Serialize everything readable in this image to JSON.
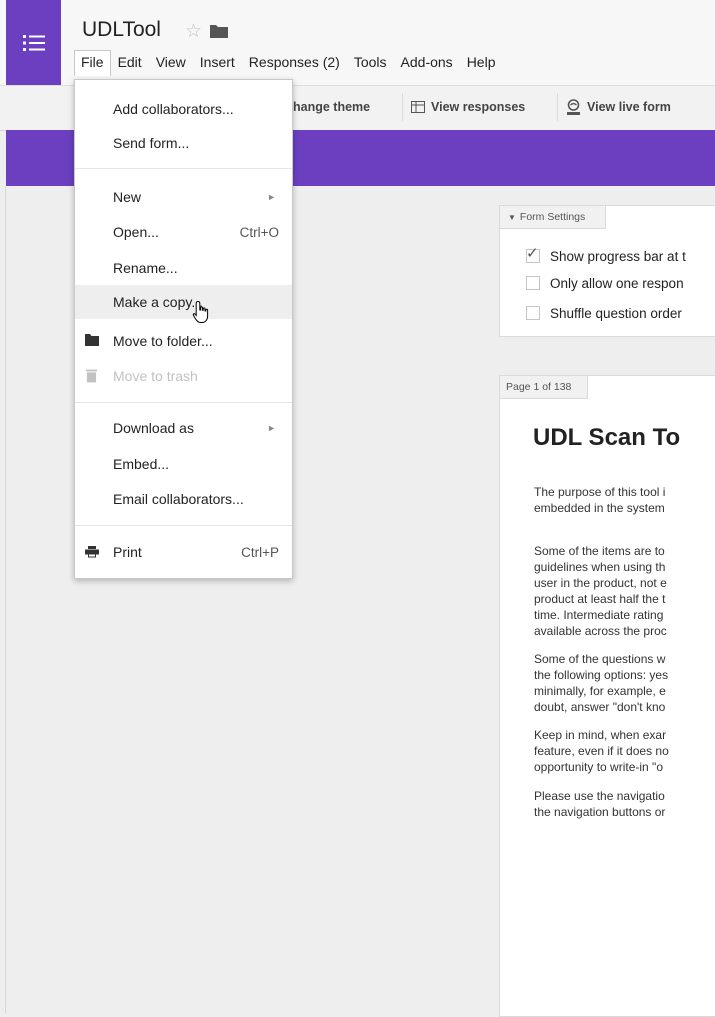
{
  "header": {
    "doc_title": "UDLTool",
    "menubar": [
      "File",
      "Edit",
      "View",
      "Insert",
      "Responses (2)",
      "Tools",
      "Add-ons",
      "Help"
    ]
  },
  "toolbar": {
    "change_theme": "hange theme",
    "view_responses": "View responses",
    "view_live_form": "View live form"
  },
  "file_menu": {
    "add_collaborators": "Add collaborators...",
    "send_form": "Send form...",
    "new": "New",
    "open": "Open...",
    "open_shortcut": "Ctrl+O",
    "rename": "Rename...",
    "make_copy": "Make a copy...",
    "move_to_folder": "Move to folder...",
    "move_to_trash": "Move to trash",
    "download_as": "Download as",
    "embed": "Embed...",
    "email_collaborators": "Email collaborators...",
    "print": "Print",
    "print_shortcut": "Ctrl+P"
  },
  "settings": {
    "tab_label": "Form Settings",
    "options": [
      {
        "label": "Show progress bar at t",
        "checked": true
      },
      {
        "label": "Only allow one respon",
        "checked": false
      },
      {
        "label": "Shuffle question order",
        "checked": false
      }
    ]
  },
  "page": {
    "tab_label": "Page 1 of 138",
    "title": "UDL Scan To",
    "paragraphs": [
      [
        "The purpose of this tool i",
        "embedded in the system"
      ],
      [
        "Some of the items are to",
        "guidelines when using th",
        "user in the product, not e",
        "product at least half the t",
        "time.  Intermediate rating",
        "available across the proc"
      ],
      [
        "Some of the questions w",
        "the following options: yes",
        "minimally, for example, e",
        "doubt, answer \"don't kno"
      ],
      [
        "Keep in mind, when exar",
        "feature, even if it does no",
        "opportunity to write-in \"o"
      ],
      [
        "Please use the navigatio",
        "the navigation buttons or"
      ]
    ]
  },
  "colors": {
    "brand_purple": "#6b3fbf",
    "background": "#eeeeee"
  }
}
